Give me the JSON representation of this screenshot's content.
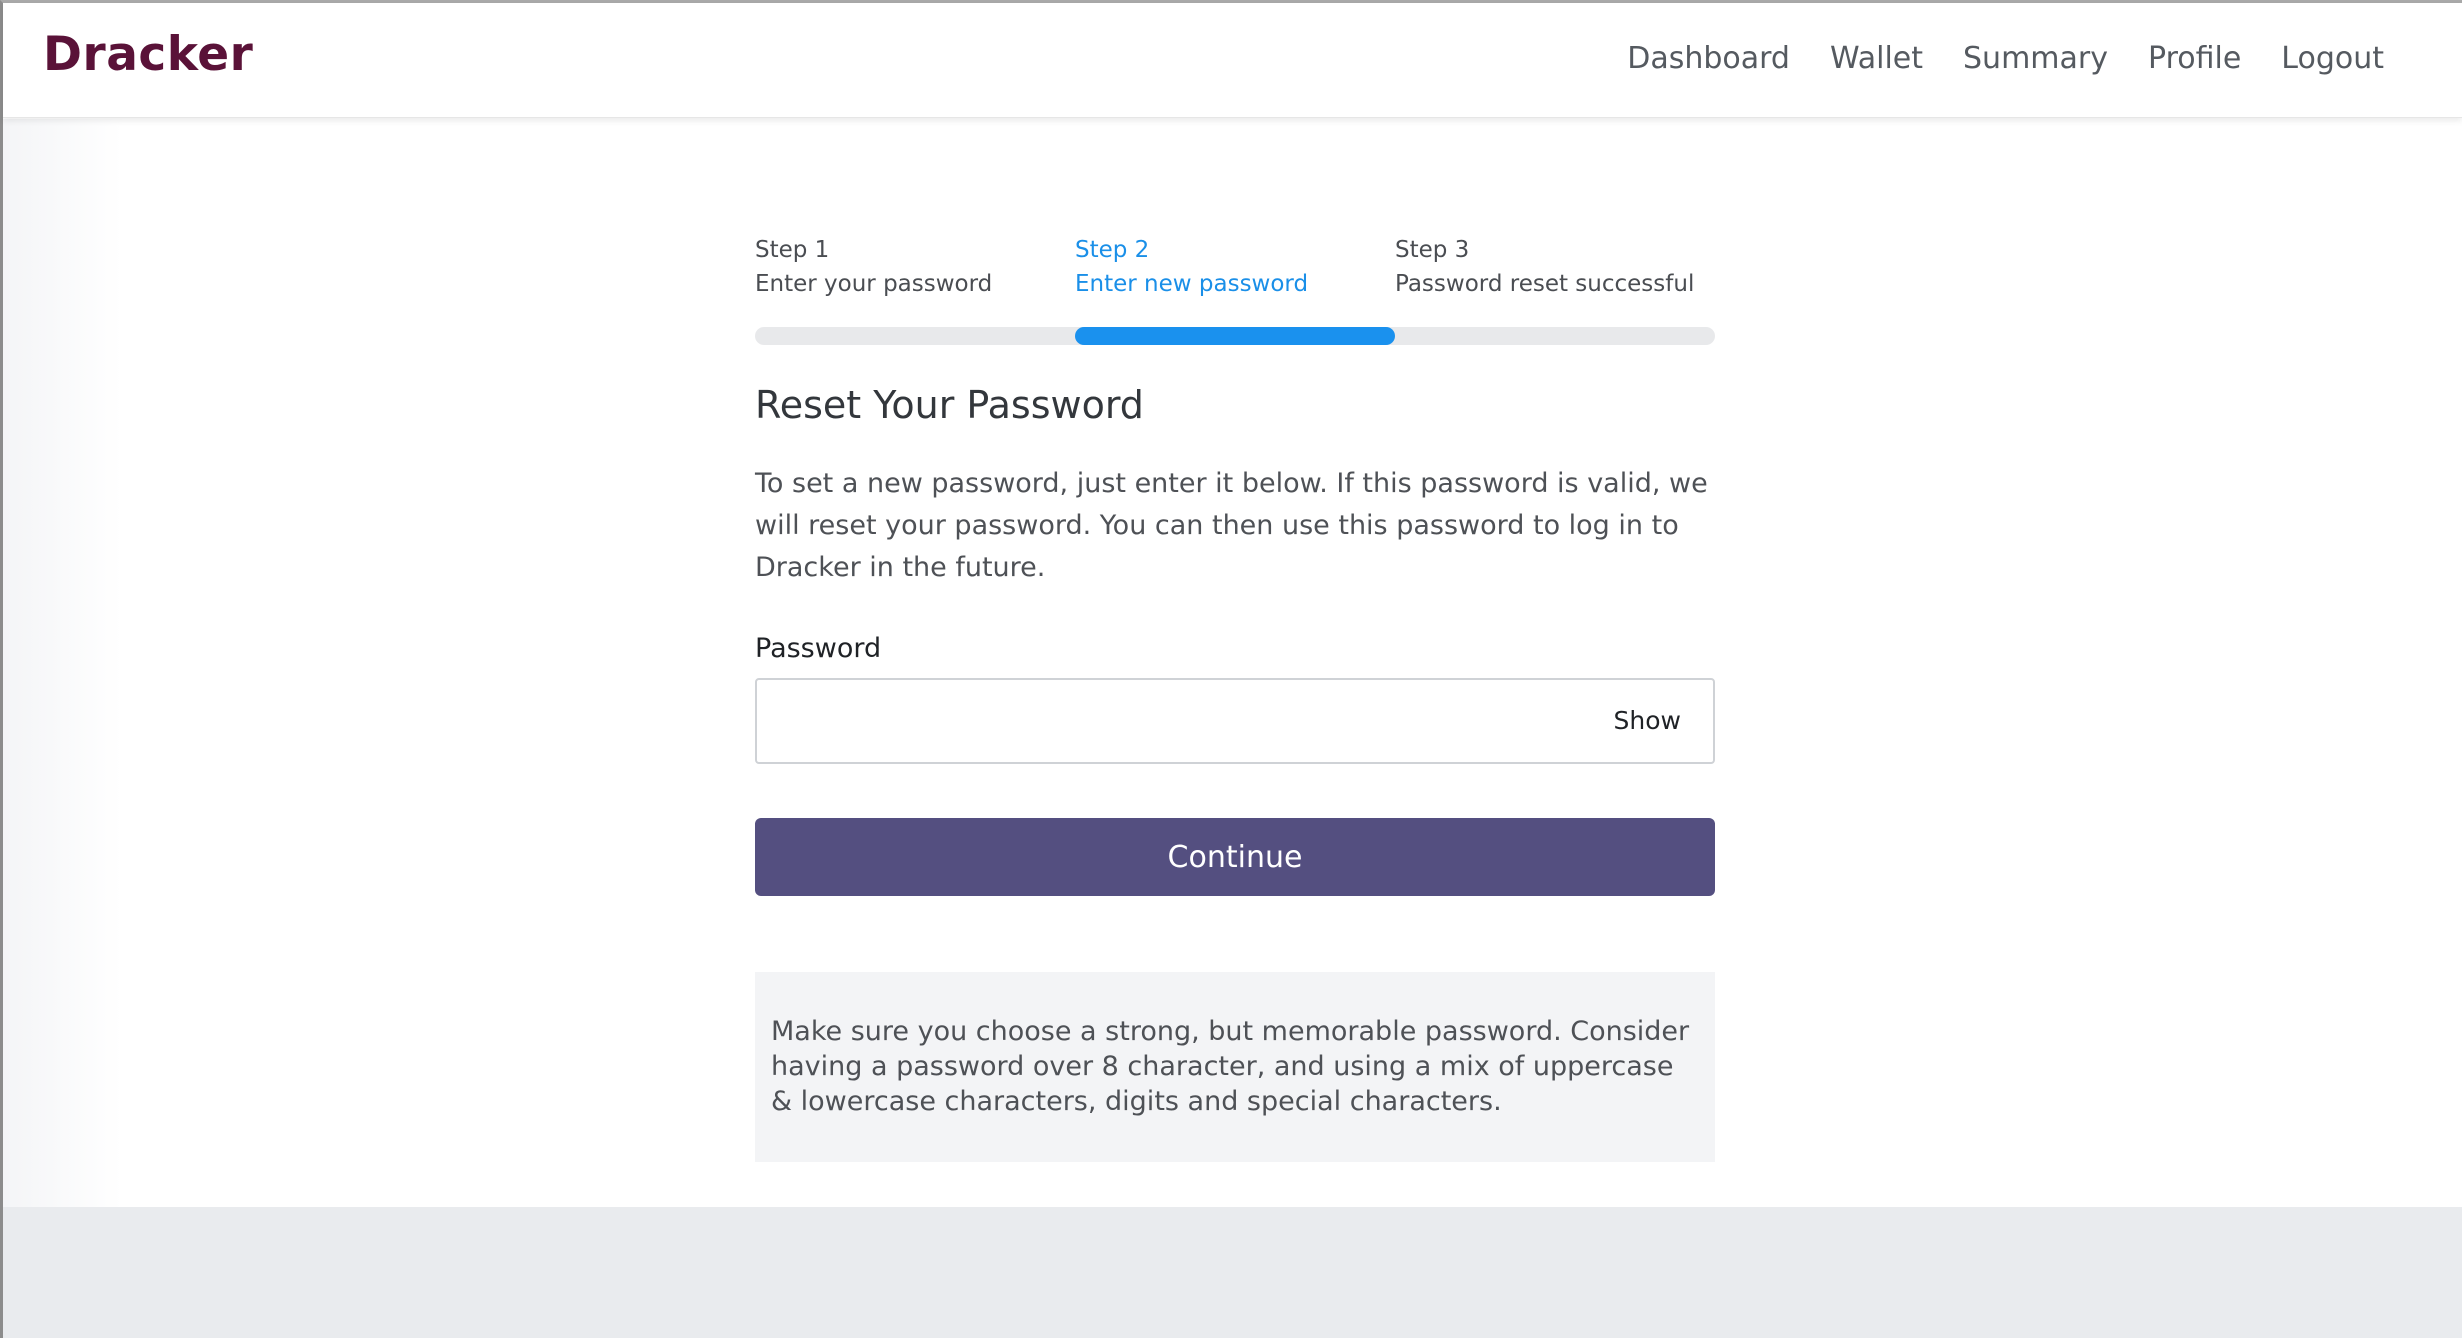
{
  "brand": "Dracker",
  "nav": {
    "items": [
      "Dashboard",
      "Wallet",
      "Summary",
      "Profile",
      "Logout"
    ]
  },
  "steps": [
    {
      "number": "Step 1",
      "label": "Enter your password",
      "active": false
    },
    {
      "number": "Step 2",
      "label": "Enter new password",
      "active": true
    },
    {
      "number": "Step 3",
      "label": "Password reset successful",
      "active": false
    }
  ],
  "progress": {
    "current_step": 2,
    "total_steps": 3
  },
  "main": {
    "title": "Reset Your Password",
    "description": "To set a new password, just enter it below. If this password is valid, we will reset your password. You can then use this password to log in to Dracker in the future.",
    "password_label": "Password",
    "password_value": "",
    "show_label": "Show",
    "continue_label": "Continue",
    "tip": "Make sure you choose a strong, but memorable password. Consider having a password over 8 character, and using a mix of uppercase & lowercase characters, digits and special characters."
  },
  "colors": {
    "brand": "#5a1238",
    "accent": "#1a91ee",
    "button": "#544f80"
  }
}
